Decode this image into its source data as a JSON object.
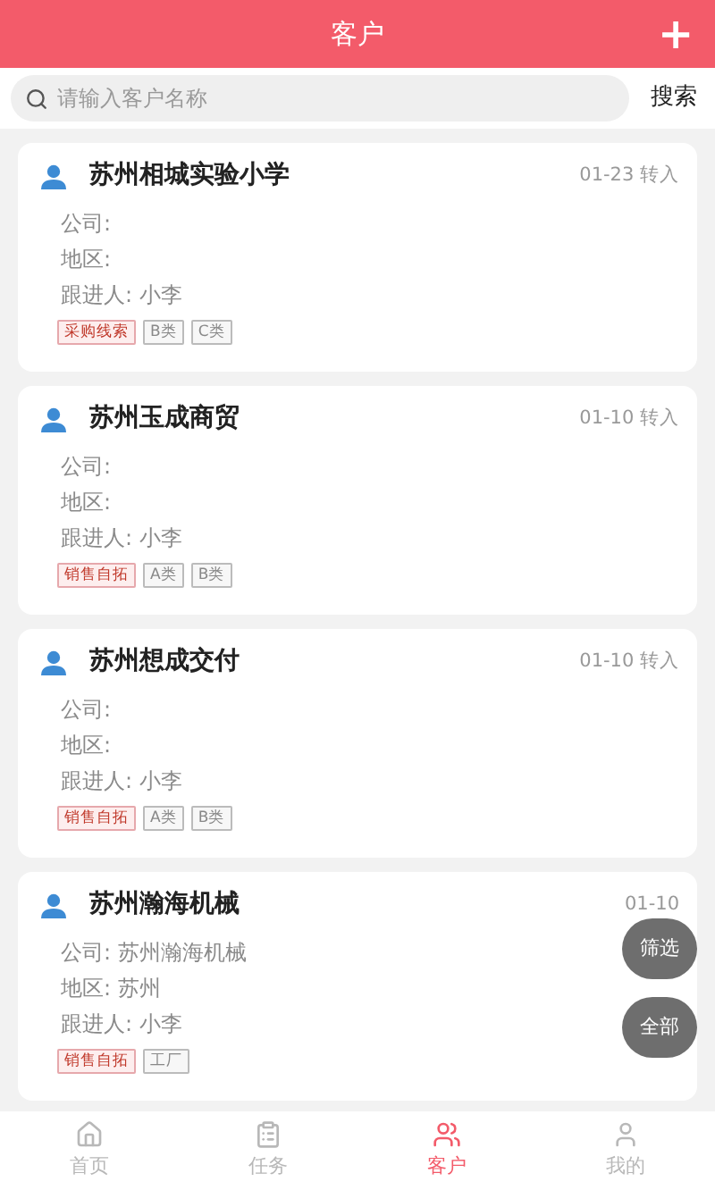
{
  "header": {
    "title": "客户",
    "add_label": "+"
  },
  "search": {
    "placeholder": "请输入客户名称",
    "button": "搜索"
  },
  "customers": [
    {
      "name": "苏州相城实验小学",
      "time": "01-23 转入",
      "company_label": "公司:",
      "region_label": "地区:",
      "owner_label": "跟进人:",
      "owner": "小李",
      "tags": [
        {
          "label": "采购线索",
          "kind": "source"
        },
        {
          "label": "B类",
          "kind": "grade"
        },
        {
          "label": "C类",
          "kind": "grade"
        }
      ]
    },
    {
      "name": "苏州玉成商贸",
      "time": "01-10 转入",
      "company_label": "公司:",
      "region_label": "地区:",
      "owner_label": "跟进人:",
      "owner": "小李",
      "tags": [
        {
          "label": "销售自拓",
          "kind": "source"
        },
        {
          "label": "A类",
          "kind": "grade"
        },
        {
          "label": "B类",
          "kind": "grade"
        }
      ]
    },
    {
      "name": "苏州想成交付",
      "time": "01-10 转入",
      "company_label": "公司:",
      "region_label": "地区:",
      "owner_label": "跟进人:",
      "owner": "小李",
      "tags": [
        {
          "label": "销售自拓",
          "kind": "source"
        },
        {
          "label": "A类",
          "kind": "grade"
        },
        {
          "label": "B类",
          "kind": "grade"
        }
      ]
    },
    {
      "name": "苏州瀚海机械",
      "time": "01-10",
      "company_label": "公司:",
      "company": "苏州瀚海机械",
      "region_label": "地区:",
      "region": "苏州",
      "owner_label": "跟进人:",
      "owner": "小李",
      "tags": [
        {
          "label": "销售自拓",
          "kind": "source"
        },
        {
          "label": "工厂",
          "kind": "grade"
        }
      ]
    }
  ],
  "floating_buttons": [
    "筛选",
    "全部"
  ],
  "tab_bar": [
    {
      "label": "首页",
      "selected": false
    },
    {
      "label": "任务",
      "selected": false
    },
    {
      "label": "客户",
      "selected": true
    },
    {
      "label": "我的",
      "selected": false
    }
  ]
}
